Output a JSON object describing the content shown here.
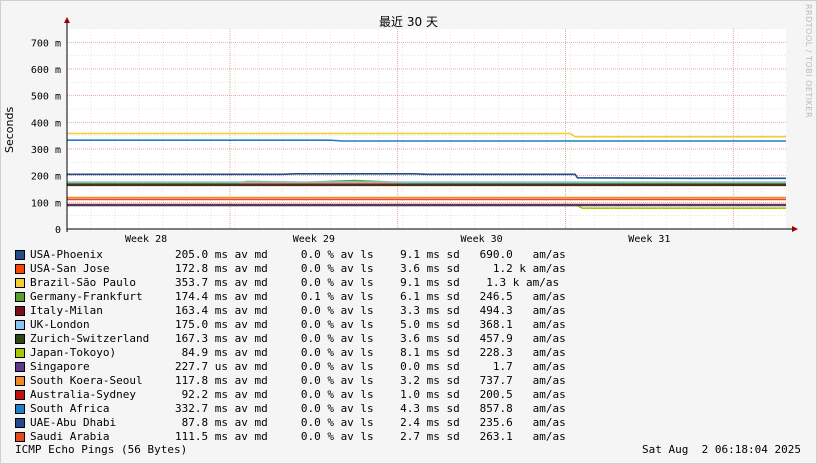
{
  "chart_data": {
    "type": "line",
    "title": "最近 30 天",
    "ylabel": "Seconds",
    "ylim": [
      0,
      750
    ],
    "y_ticks": [
      {
        "value": 0,
        "label": "0"
      },
      {
        "value": 100,
        "label": "100 m"
      },
      {
        "value": 200,
        "label": "200 m"
      },
      {
        "value": 300,
        "label": "300 m"
      },
      {
        "value": 400,
        "label": "400 m"
      },
      {
        "value": 500,
        "label": "500 m"
      },
      {
        "value": 600,
        "label": "600 m"
      },
      {
        "value": 700,
        "label": "700 m"
      }
    ],
    "x_day_range": [
      0,
      30
    ],
    "x_ticks": [
      {
        "day": 3.3,
        "label": "Week 28"
      },
      {
        "day": 10.3,
        "label": "Week 29"
      },
      {
        "day": 17.3,
        "label": "Week 30"
      },
      {
        "day": 24.3,
        "label": "Week 31"
      }
    ],
    "week_boundaries": [
      6.8,
      13.8,
      20.8,
      27.8
    ],
    "grid": true,
    "series": [
      {
        "name": "USA-Phoenix",
        "color": "#1f4e8c",
        "median_ms": "205.0",
        "loss": "0.1",
        "sd_ms": "9.1",
        "points": [
          [
            0,
            205
          ],
          [
            9,
            205
          ],
          [
            9.5,
            207
          ],
          [
            14.5,
            207
          ],
          [
            15,
            205
          ],
          [
            21.2,
            205
          ],
          [
            21.3,
            192
          ],
          [
            26,
            190
          ],
          [
            30,
            190
          ]
        ]
      },
      {
        "name": "USA-San Jose",
        "color": "#ff4400",
        "median_ms": "172.8",
        "loss": "0.0",
        "sd_ms": "3.6",
        "points": [
          [
            0,
            173
          ],
          [
            30,
            173
          ]
        ]
      },
      {
        "name": "Brazil-São Paulo",
        "color": "#f2cf30",
        "median_ms": "353.7",
        "loss": "0.0",
        "sd_ms": "9.1",
        "points": [
          [
            0,
            358
          ],
          [
            21,
            358
          ],
          [
            21.2,
            346
          ],
          [
            30,
            346
          ]
        ]
      },
      {
        "name": "Germany-Frankfurt",
        "color": "#5aa02c",
        "median_ms": "174.4",
        "loss": "0.1",
        "sd_ms": "6.1",
        "points": [
          [
            0,
            170
          ],
          [
            7,
            170
          ],
          [
            7.5,
            178
          ],
          [
            10,
            175
          ],
          [
            12,
            182
          ],
          [
            14.5,
            172
          ],
          [
            21,
            172
          ],
          [
            30,
            172
          ]
        ]
      },
      {
        "name": "Italy-Milan",
        "color": "#7a0f1e",
        "median_ms": "163.4",
        "loss": "0.0",
        "sd_ms": "3.3",
        "points": [
          [
            0,
            164
          ],
          [
            30,
            164
          ]
        ]
      },
      {
        "name": "UK-London",
        "color": "#8ac4f0",
        "median_ms": "175.0",
        "loss": "0.0",
        "sd_ms": "5.0",
        "points": [
          [
            0,
            176
          ],
          [
            30,
            176
          ]
        ]
      },
      {
        "name": "Zurich-Switzerland",
        "color": "#2c4716",
        "median_ms": "167.3",
        "loss": "0.0",
        "sd_ms": "3.6",
        "points": [
          [
            0,
            167
          ],
          [
            30,
            167
          ]
        ]
      },
      {
        "name": "Japan-Tokoyo)",
        "color": "#a8c800",
        "median_ms": "84.9",
        "loss": "0.0",
        "sd_ms": "8.1",
        "points": [
          [
            0,
            88
          ],
          [
            21.3,
            88
          ],
          [
            21.5,
            78
          ],
          [
            30,
            78
          ]
        ]
      },
      {
        "name": "Singapore",
        "color": "#5e3a8c",
        "median_ms": "227.7",
        "loss": "0.0",
        "sd_ms": "0.0",
        "points": []
      },
      {
        "name": "South Koera-Seoul",
        "color": "#f08a24",
        "median_ms": "117.8",
        "loss": "0.0",
        "sd_ms": "3.2",
        "points": [
          [
            0,
            118
          ],
          [
            30,
            118
          ]
        ]
      },
      {
        "name": "Australia-Sydney",
        "color": "#c01010",
        "median_ms": "92.2",
        "loss": "0.0",
        "sd_ms": "1.0",
        "points": [
          [
            0,
            92
          ],
          [
            30,
            92
          ]
        ]
      },
      {
        "name": "South Africa",
        "color": "#1f7fc8",
        "median_ms": "332.7",
        "loss": "0.0",
        "sd_ms": "4.3",
        "points": [
          [
            0,
            333
          ],
          [
            11,
            333
          ],
          [
            11.5,
            330
          ],
          [
            30,
            330
          ]
        ]
      },
      {
        "name": "UAE-Abu Dhabi",
        "color": "#234a8c",
        "median_ms": "87.8",
        "loss": "0.0",
        "sd_ms": "2.4",
        "points": [
          [
            0,
            88
          ],
          [
            30,
            88
          ]
        ]
      },
      {
        "name": "Saudi Arabia",
        "color": "#e84a20",
        "median_ms": "111.5",
        "loss": "0.0",
        "sd_ms": "2.7",
        "points": [
          [
            0,
            111
          ],
          [
            30,
            111
          ]
        ]
      }
    ]
  },
  "legend_rows": [
    {
      "name": "USA-Phoenix",
      "stats": "205.0 ms av md     0.0 % av ls    9.1 ms sd   690.0   am/as"
    },
    {
      "name": "USA-San Jose",
      "stats": "172.8 ms av md     0.0 % av ls    3.6 ms sd     1.2 k am/as"
    },
    {
      "name": "Brazil-São Paulo",
      "stats": "353.7 ms av md     0.0 % av ls    9.1 ms sd    1.3 k am/as"
    },
    {
      "name": "Germany-Frankfurt",
      "stats": "174.4 ms av md     0.1 % av ls    6.1 ms sd   246.5   am/as"
    },
    {
      "name": "Italy-Milan",
      "stats": "163.4 ms av md     0.0 % av ls    3.3 ms sd   494.3   am/as"
    },
    {
      "name": "UK-London",
      "stats": "175.0 ms av md     0.0 % av ls    5.0 ms sd   368.1   am/as"
    },
    {
      "name": "Zurich-Switzerland",
      "stats": "167.3 ms av md     0.0 % av ls    3.6 ms sd   457.9   am/as"
    },
    {
      "name": "Japan-Tokoyo)",
      "stats": " 84.9 ms av md     0.0 % av ls    8.1 ms sd   228.3   am/as"
    },
    {
      "name": "Singapore",
      "stats": "227.7 us av md     0.0 % av ls    0.0 ms sd     1.7   am/as"
    },
    {
      "name": "South Koera-Seoul",
      "stats": "117.8 ms av md     0.0 % av ls    3.2 ms sd   737.7   am/as"
    },
    {
      "name": "Australia-Sydney",
      "stats": " 92.2 ms av md     0.0 % av ls    1.0 ms sd   200.5   am/as"
    },
    {
      "name": "South Africa",
      "stats": "332.7 ms av md     0.0 % av ls    4.3 ms sd   857.8   am/as"
    },
    {
      "name": "UAE-Abu Dhabi",
      "stats": " 87.8 ms av md     0.0 % av ls    2.4 ms sd   235.6   am/as"
    },
    {
      "name": "Saudi Arabia",
      "stats": "111.5 ms av md     0.0 % av ls    2.7 ms sd   263.1   am/as"
    }
  ],
  "footer": {
    "left": "ICMP Echo Pings (56 Bytes)",
    "right": "Sat Aug  2 06:18:04 2025"
  },
  "watermark": "RRDTOOL / TOBI OETIKER"
}
